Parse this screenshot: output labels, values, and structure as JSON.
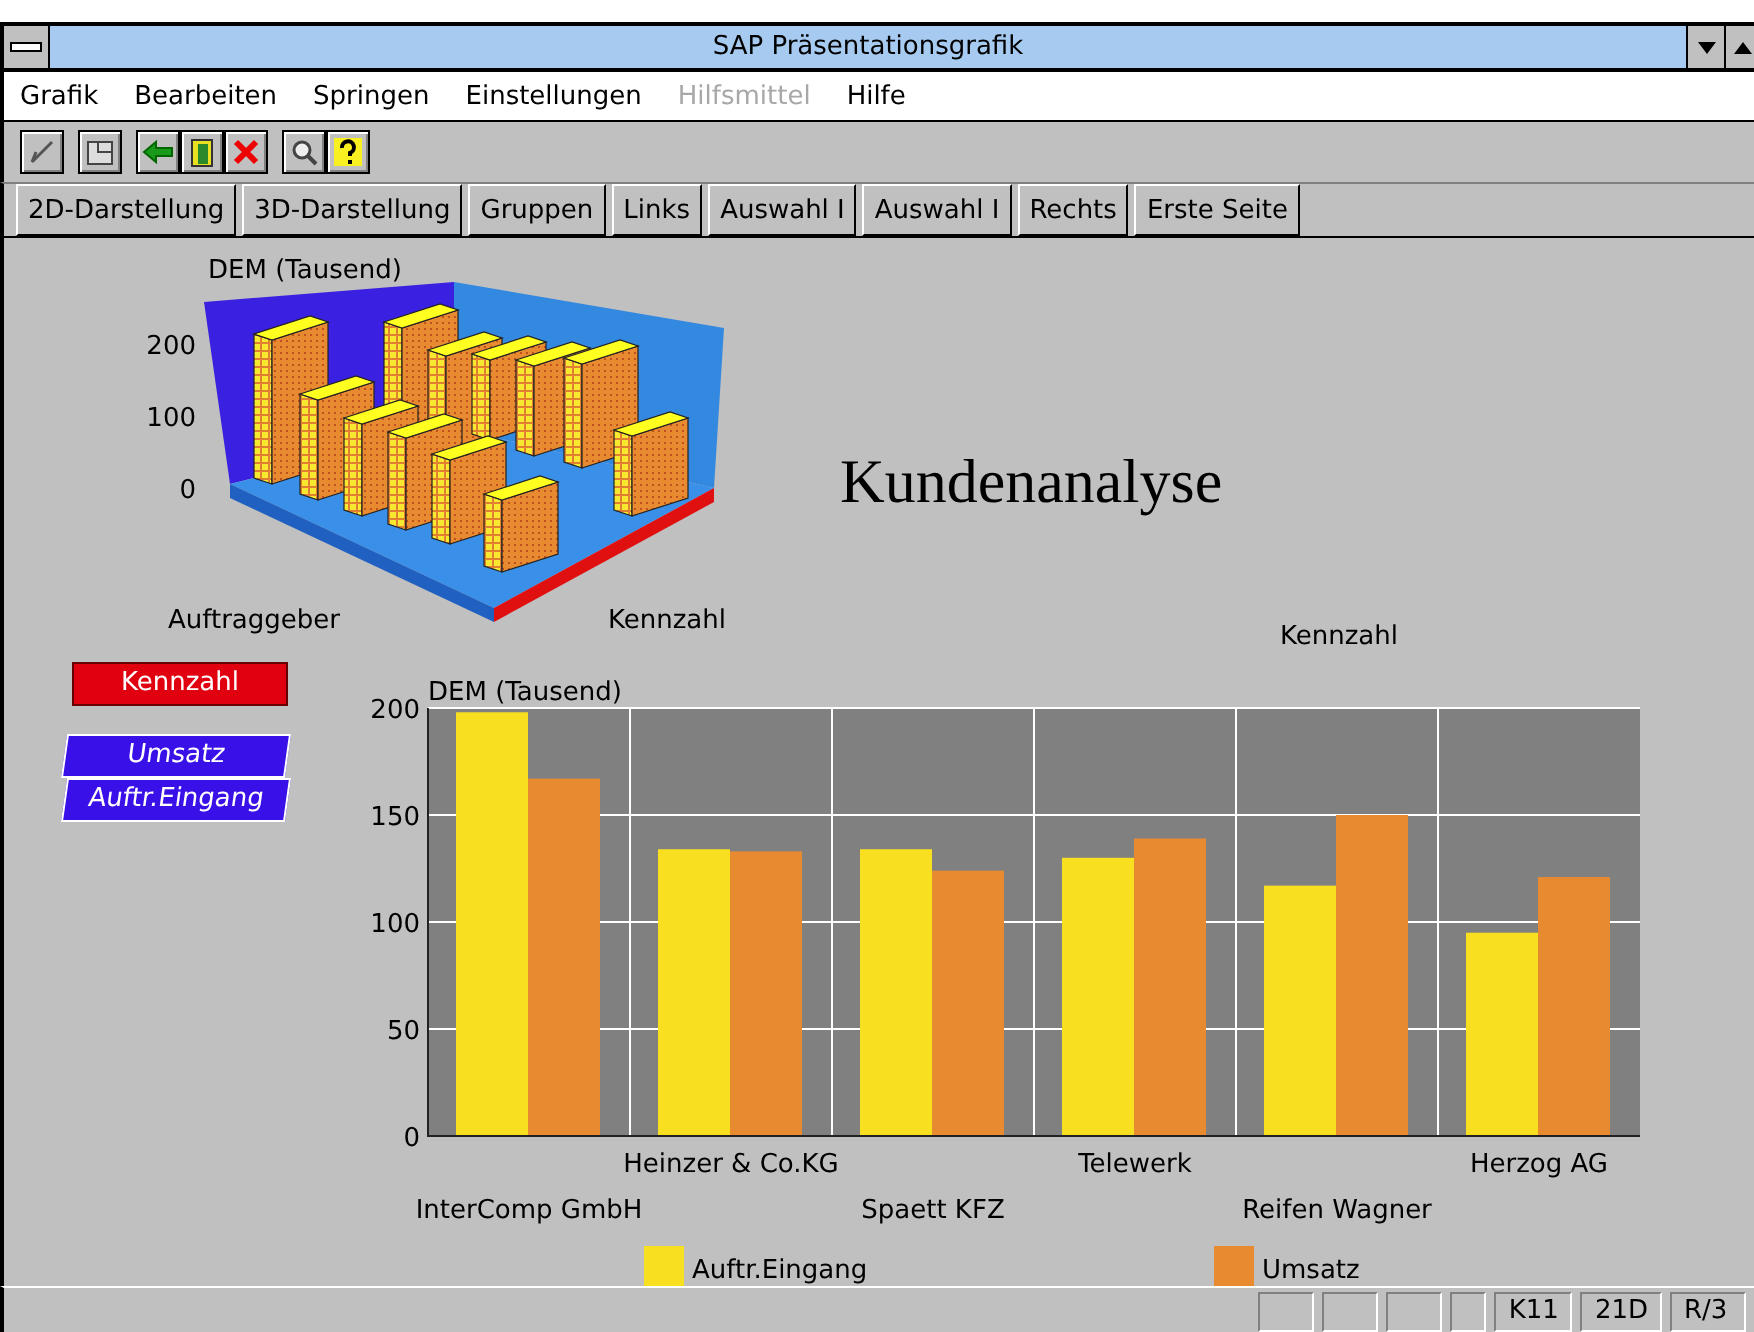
{
  "window": {
    "title": "SAP Präsentationsgrafik"
  },
  "menu": [
    {
      "label": "Grafik",
      "disabled": false
    },
    {
      "label": "Bearbeiten",
      "disabled": false
    },
    {
      "label": "Springen",
      "disabled": false
    },
    {
      "label": "Einstellungen",
      "disabled": false
    },
    {
      "label": "Hilfsmittel",
      "disabled": true
    },
    {
      "label": "Hilfe",
      "disabled": false
    }
  ],
  "toolbar": [
    {
      "kind": "check"
    },
    {
      "kind": "print"
    },
    {
      "kind": "back"
    },
    {
      "kind": "exit"
    },
    {
      "kind": "cancel"
    },
    {
      "kind": "find"
    },
    {
      "kind": "help"
    }
  ],
  "buttons": [
    "2D-Darstellung",
    "3D-Darstellung",
    "Gruppen",
    "Links",
    "Auswahl I",
    "Auswahl I",
    "Rechts",
    "Erste Seite"
  ],
  "chart3d": {
    "ylabel": "DEM (Tausend)",
    "ticks": [
      "200",
      "100",
      "0"
    ],
    "xlabel": "Auftraggeber",
    "zlabel": "Kennzahl"
  },
  "title": "Kundenanalyse",
  "legend_boxes": [
    {
      "label": "Kennzahl",
      "kind": "header"
    },
    {
      "label": "Umsatz",
      "kind": "series"
    },
    {
      "label": "Auftr.Eingang",
      "kind": "series"
    }
  ],
  "series_title": "Kennzahl",
  "chart_data": {
    "type": "bar",
    "grid": true,
    "legend": true,
    "ylabel": "DEM (Tausend)",
    "categories": [
      "InterComp GmbH",
      "Heinzer & Co.KG",
      "Spaett KFZ",
      "Telewerk",
      "Reifen Wagner",
      "Herzog AG"
    ],
    "ylim": [
      0,
      200
    ],
    "yticks": [
      0,
      50,
      100,
      150,
      200
    ],
    "series": [
      {
        "name": "Auftr.Eingang",
        "color": "#f8e020",
        "values": [
          198,
          134,
          134,
          130,
          117,
          95
        ]
      },
      {
        "name": "Umsatz",
        "color": "#e88a30",
        "values": [
          167,
          133,
          124,
          139,
          150,
          121
        ]
      }
    ]
  },
  "status_bar": [
    "K11",
    "21D",
    "R/3"
  ]
}
